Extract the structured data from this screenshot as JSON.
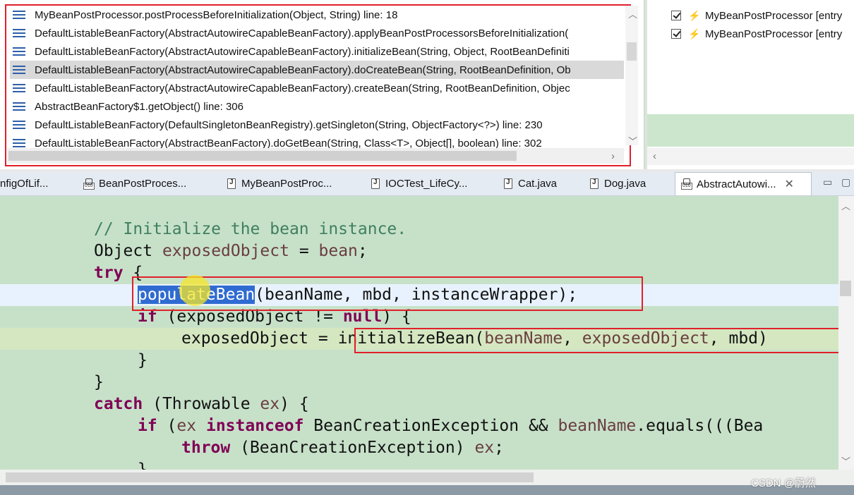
{
  "stack": {
    "frames": [
      {
        "text": "MyBeanPostProcessor.postProcessBeforeInitialization(Object, String) line: 18",
        "selected": false
      },
      {
        "text": "DefaultListableBeanFactory(AbstractAutowireCapableBeanFactory).applyBeanPostProcessorsBeforeInitialization(",
        "selected": false
      },
      {
        "text": "DefaultListableBeanFactory(AbstractAutowireCapableBeanFactory).initializeBean(String, Object, RootBeanDefiniti",
        "selected": false
      },
      {
        "text": "DefaultListableBeanFactory(AbstractAutowireCapableBeanFactory).doCreateBean(String, RootBeanDefinition, Ob",
        "selected": true
      },
      {
        "text": "DefaultListableBeanFactory(AbstractAutowireCapableBeanFactory).createBean(String, RootBeanDefinition, Objec",
        "selected": false
      },
      {
        "text": "AbstractBeanFactory$1.getObject() line: 306",
        "selected": false
      },
      {
        "text": "DefaultListableBeanFactory(DefaultSingletonBeanRegistry).getSingleton(String, ObjectFactory<?>) line: 230",
        "selected": false
      },
      {
        "text": "DefaultListableBeanFactory(AbstractBeanFactory).doGetBean(String, Class<T>, Object[], boolean) line: 302",
        "selected": false
      }
    ],
    "accent": "#e0202a"
  },
  "breakpoints": {
    "items": [
      {
        "label": "MyBeanPostProcessor [entry"
      },
      {
        "label": "MyBeanPostProcessor [entry"
      }
    ]
  },
  "tabs": [
    {
      "label": "nfigOfLif...",
      "icon": "java-file-icon",
      "active": false
    },
    {
      "label": "BeanPostProces...",
      "icon": "class-file-icon",
      "active": false
    },
    {
      "label": "MyBeanPostProc...",
      "icon": "java-file-icon",
      "active": false
    },
    {
      "label": "IOCTest_LifeCy...",
      "icon": "java-file-icon",
      "active": false
    },
    {
      "label": "Cat.java",
      "icon": "java-file-icon",
      "active": false
    },
    {
      "label": "Dog.java",
      "icon": "java-file-icon",
      "active": false
    },
    {
      "label": "AbstractAutowi...",
      "icon": "class-file-icon",
      "active": true
    }
  ],
  "code": {
    "l1": "// Initialize the bean instance.",
    "l2_type": "Object",
    "l2_var": "exposedObject",
    "l2_rest": " = ",
    "l2_bean": "bean",
    "l2_end": ";",
    "l3_kw": "try",
    "l3_rest": " {",
    "l4_sel": "populateBean",
    "l4_rest": "(beanName, mbd, instanceWrapper);",
    "l5_kw": "if",
    "l5_a": " (exposedObject != ",
    "l5_null": "null",
    "l5_b": ") {",
    "l6_a": "exposedObject = ",
    "l6_b": "initializeBean(",
    "l6_f1": "beanName",
    "l6_c": ", ",
    "l6_f2": "exposedObject",
    "l6_d": ", mbd)",
    "l7": "}",
    "l8": "}",
    "l9_kw": "catch",
    "l9_rest": " (Throwable ",
    "l9_var": "ex",
    "l9_end": ") {",
    "l10_kw": "if",
    "l10_a": " (",
    "l10_var": "ex",
    "l10_kw2": "instanceof",
    "l10_b": " BeanCreationException && ",
    "l10_f": "beanName",
    "l10_c": ".equals(((Bea",
    "l11_kw": "throw",
    "l11_a": " (BeanCreationException) ",
    "l11_var": "ex",
    "l11_end": ";",
    "l12": "}"
  },
  "watermark": "CSDN @蔚然"
}
